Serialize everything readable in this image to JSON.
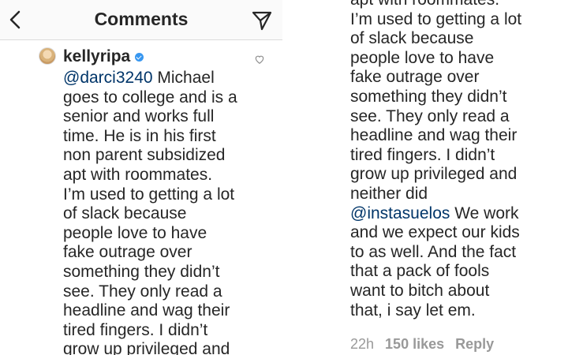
{
  "header": {
    "title": "Comments",
    "back_icon": "chevron-left-icon",
    "send_icon": "paper-plane-icon"
  },
  "comment": {
    "username": "kellyripa",
    "verified": true,
    "mention_1": "@darci3240",
    "text_1": " Michael\ngoes to college and is a\nsenior and works full\ntime. He is in his first\nnon parent subsidized\napt with roommates.\nI’m used to getting a lot\nof slack because\npeople love to have\nfake outrage over\nsomething they didn’t\nsee. They only read a\nheadline and wag their\ntired fingers. I didn’t\ngrow up privileged and",
    "right_text_1": "apt with roommates.\nI’m used to getting a lot\nof slack because\npeople love to have\nfake outrage over\nsomething they didn’t\nsee. They only read a\nheadline and wag their\ntired fingers. I didn’t\ngrow up privileged and\nneither did\n",
    "mention_2": "@instasuelos",
    "right_text_2": " We work\nand we expect our kids\nto as well. And the fact\nthat a pack of fools\nwant to bitch about\nthat, i say let em.",
    "time": "22h",
    "likes": "150 likes",
    "reply_label": "Reply"
  },
  "colors": {
    "mention": "#003569",
    "meta": "#999999",
    "verified": "#3897f0"
  }
}
